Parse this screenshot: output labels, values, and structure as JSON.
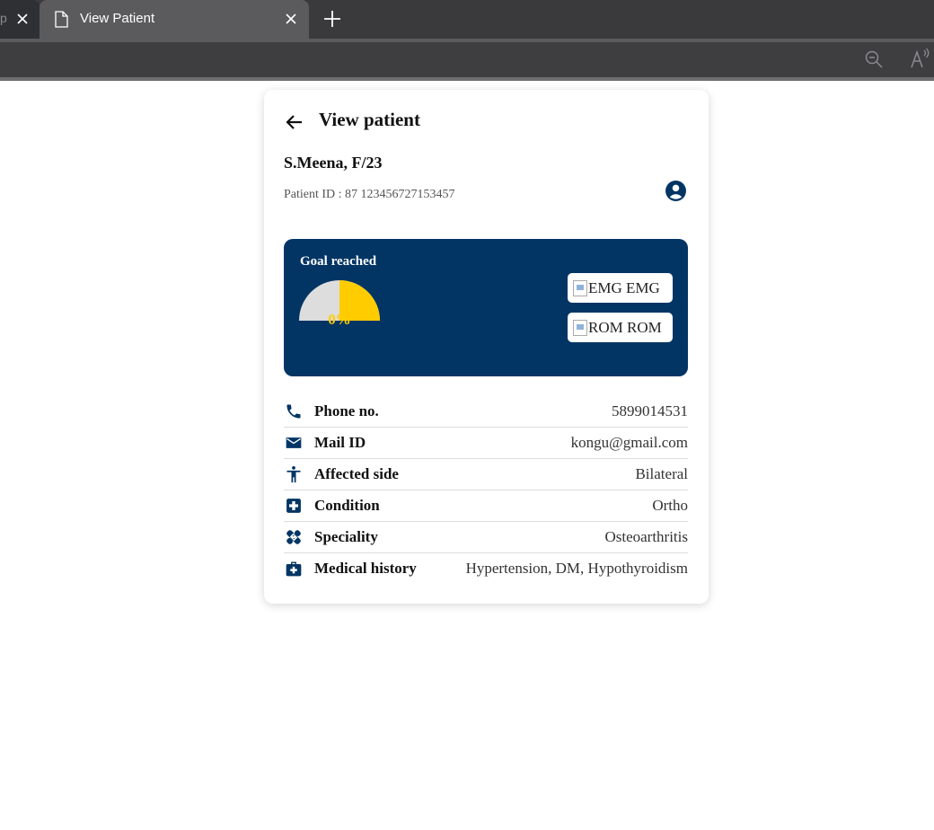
{
  "browser": {
    "prev_tab_fragment": "p",
    "active_tab_title": "View Patient"
  },
  "page": {
    "title": "View patient",
    "patient_name": "S.Meena, F/23",
    "patient_id": "Patient ID : 87 123456727153457"
  },
  "goal": {
    "label": "Goal reached",
    "percent_text": "0%",
    "gauge_fill": 0.5,
    "emg_alt": "EMG",
    "emg_label": "EMG",
    "rom_alt": "ROM",
    "rom_label": "ROM"
  },
  "details": [
    {
      "icon": "phone-icon",
      "label": "Phone no.",
      "value": "5899014531"
    },
    {
      "icon": "mail-icon",
      "label": "Mail ID",
      "value": "kongu@gmail.com"
    },
    {
      "icon": "person-icon",
      "label": "Affected side",
      "value": "Bilateral"
    },
    {
      "icon": "medical-cross-icon",
      "label": "Condition",
      "value": "Ortho"
    },
    {
      "icon": "bandage-icon",
      "label": "Speciality",
      "value": "Osteoarthritis"
    },
    {
      "icon": "medical-bag-icon",
      "label": "Medical history",
      "value": "Hypertension, DM, Hypothyroidism"
    }
  ],
  "colors": {
    "primary": "#023564",
    "gauge_fill": "#ffcc00",
    "gauge_track": "#dddddd"
  }
}
